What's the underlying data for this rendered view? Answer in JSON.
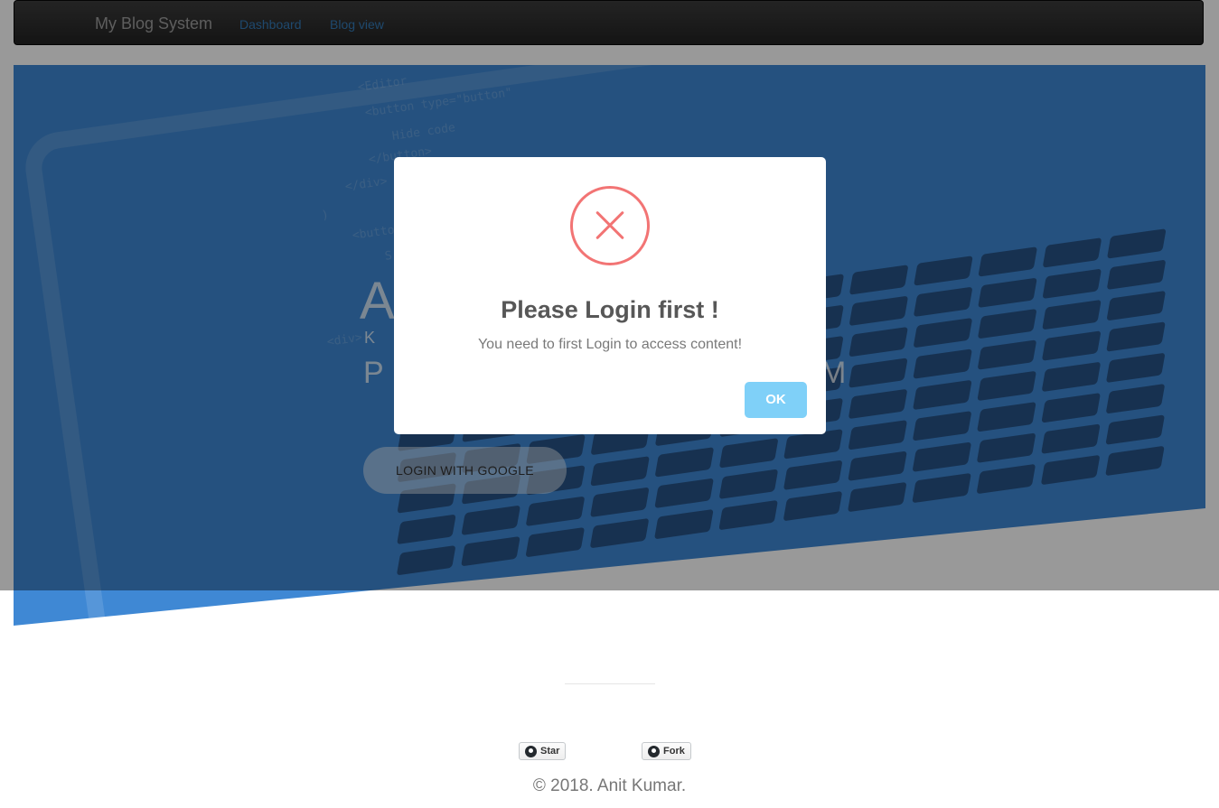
{
  "navbar": {
    "brand": "My Blog System",
    "links": [
      "Dashboard",
      "Blog view"
    ]
  },
  "hero": {
    "partial_letters": [
      "A",
      "K",
      "P",
      "M"
    ],
    "google_button": "LOGIN WITH GOOGLE",
    "background_code": [
      "<Editor",
      "<button type=\"button\"",
      "Hide code",
      "</button>",
      "</div>",
      ")",
      "<button",
      "S",
      "<div>"
    ]
  },
  "footer": {
    "star_label": "Star",
    "fork_label": "Fork",
    "copyright": "© 2018. Anit Kumar."
  },
  "modal": {
    "icon": "error-x-icon",
    "title": "Please Login first !",
    "text": "You need to first Login to access content!",
    "ok_label": "OK"
  },
  "colors": {
    "hero": "#3f88d4",
    "error": "#f27474",
    "ok_button": "#7fd0f8",
    "link": "#337ab7"
  }
}
